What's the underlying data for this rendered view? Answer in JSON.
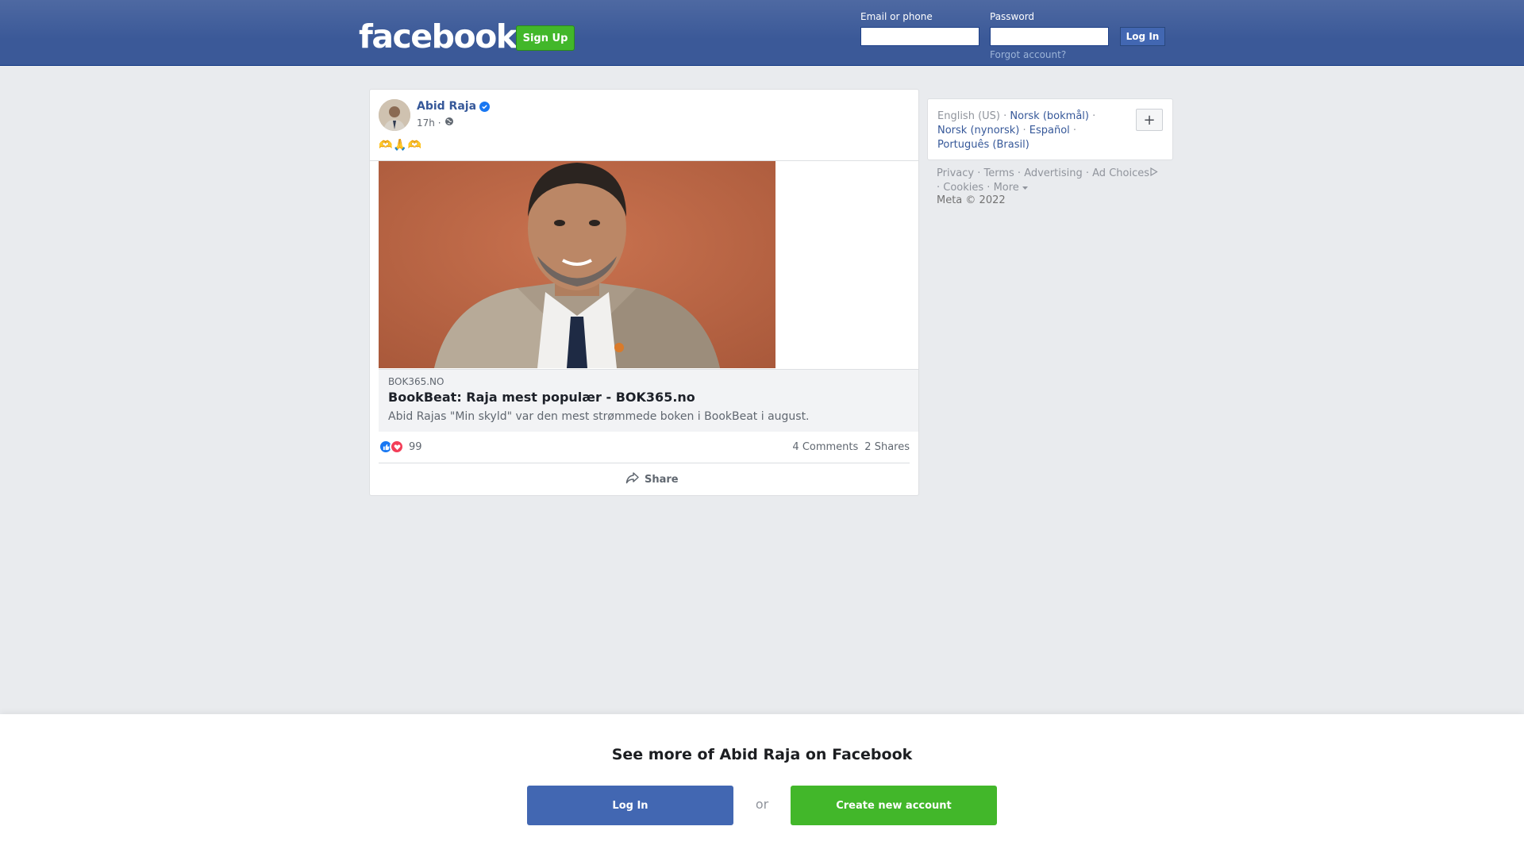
{
  "header": {
    "logo": "facebook",
    "signup_label": "Sign Up",
    "email_label": "Email or phone",
    "email_value": "",
    "password_label": "Password",
    "password_value": "",
    "login_label": "Log In",
    "forgot_label": "Forgot account?"
  },
  "post": {
    "author": "Abid Raja",
    "time": "17h ·",
    "text": "🫶🙏🫶",
    "link": {
      "domain": "BOK365.NO",
      "title": "BookBeat: Raja mest populær - BOK365.no",
      "description": "Abid Rajas \"Min skyld\" var den mest strømmede boken i BookBeat i august."
    },
    "reaction_count": "99",
    "comments": "4 Comments",
    "shares": "2 Shares",
    "share_label": "Share"
  },
  "sidebar": {
    "languages": {
      "current": "English (US)",
      "lang1": "Norsk (bokmål)",
      "lang2": "Norsk (nynorsk)",
      "lang3": "Español",
      "lang4": "Português (Brasil)"
    },
    "plus_label": "+",
    "footer": {
      "privacy": "Privacy",
      "terms": "Terms",
      "advertising": "Advertising",
      "ad_choices": "Ad Choices",
      "cookies": "Cookies",
      "more": "More",
      "copyright": "Meta © 2022"
    }
  },
  "banner": {
    "title": "See more of Abid Raja on Facebook",
    "login_label": "Log In",
    "or_label": "or",
    "create_label": "Create new account"
  },
  "colors": {
    "brand_blue": "#3b5998",
    "button_blue": "#4267b2",
    "green": "#42b72a",
    "link": "#365899"
  }
}
